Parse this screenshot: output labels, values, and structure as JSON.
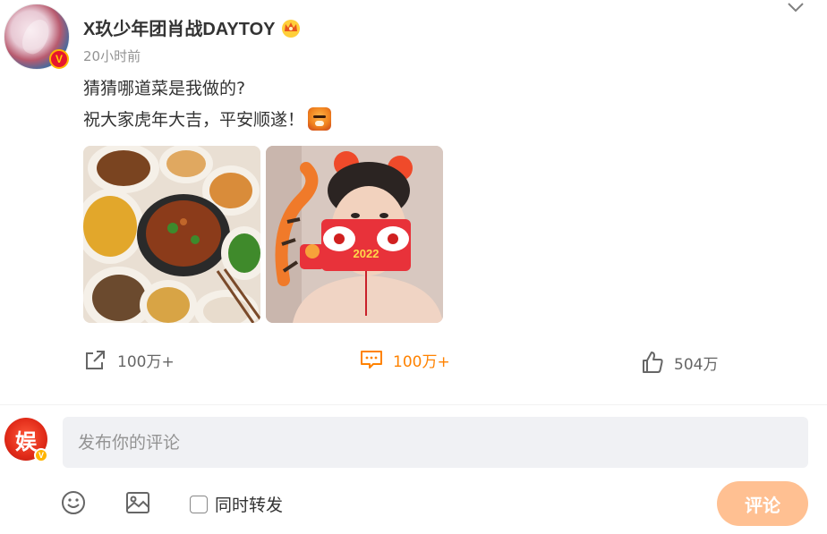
{
  "post": {
    "username": "X玖少年团肖战DAYTOY",
    "timestamp": "20小时前",
    "text_line1": "猜猜哪道菜是我做的?",
    "text_line2": "祝大家虎年大吉，平安顺遂！",
    "selfie_card_text": "2022"
  },
  "actions": {
    "share_count": "100万+",
    "comment_count": "100万+",
    "like_count": "504万"
  },
  "composer": {
    "placeholder": "发布你的评论",
    "repost_label": "同时转发",
    "submit_label": "评论"
  },
  "colors": {
    "accent": "#ff8200",
    "submit_disabled": "#ffc092",
    "input_bg": "#f0f1f4",
    "verified_red": "#e6162d",
    "verified_gold": "#ffb400"
  },
  "icons": {
    "menu": "chevron-down-icon",
    "crown": "crown-icon",
    "share": "share-icon",
    "comment": "comment-icon",
    "like": "thumbs-up-icon",
    "emoji": "emoji-icon",
    "image": "image-icon"
  }
}
